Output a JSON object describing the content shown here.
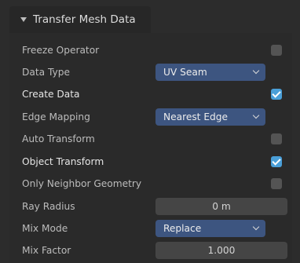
{
  "panel": {
    "title": "Transfer Mesh Data",
    "rows": [
      {
        "label": "Freeze Operator",
        "checked": false
      },
      {
        "label": "Data Type",
        "value": "UV Seam"
      },
      {
        "label": "Create Data",
        "checked": true
      },
      {
        "label": "Edge Mapping",
        "value": "Nearest Edge"
      },
      {
        "label": "Auto Transform",
        "checked": false
      },
      {
        "label": "Object Transform",
        "checked": true
      },
      {
        "label": "Only Neighbor Geometry",
        "checked": false
      },
      {
        "label": "Ray Radius",
        "value": "0 m"
      },
      {
        "label": "Mix Mode",
        "value": "Replace"
      },
      {
        "label": "Mix Factor",
        "value": "1.000"
      }
    ]
  },
  "icons": {
    "collapse": "disclosure-triangle-down-icon",
    "dropdown": "chevron-down-icon",
    "check": "checkmark-icon"
  },
  "colors": {
    "panel_bg": "#2a2a2a",
    "dropdown_bg": "#3d5580",
    "field_bg": "#454545",
    "checkbox_on": "#4a9fd8",
    "checkbox_off": "#545454"
  }
}
